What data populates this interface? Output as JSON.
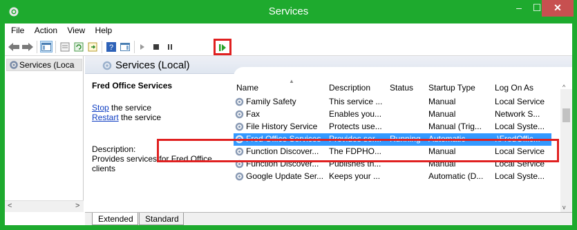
{
  "window": {
    "title": "Services",
    "minimize_glyph": "–",
    "maximize_glyph": "☐",
    "close_glyph": "✕"
  },
  "menubar": {
    "items": [
      "File",
      "Action",
      "View",
      "Help"
    ]
  },
  "toolbar": {
    "icons": [
      "back-icon",
      "forward-icon",
      "show-hide-console-tree-icon",
      "properties-icon",
      "refresh-icon",
      "export-list-icon",
      "help-icon",
      "show-action-pane-icon",
      "start-service-icon",
      "stop-service-icon",
      "pause-service-icon",
      "resume-service-icon"
    ],
    "highlighted": "resume-service-icon"
  },
  "tree": {
    "item": "Services (Loca"
  },
  "header": {
    "title": "Services (Local)"
  },
  "description_panel": {
    "service_name": "Fred Office Services",
    "stop_link": "Stop",
    "stop_suffix": " the service",
    "restart_link": "Restart",
    "restart_suffix": " the service",
    "description_label": "Description:",
    "description_line1": "Provides services for Fred Office",
    "description_line2": "clients"
  },
  "table": {
    "columns": [
      "Name",
      "Description",
      "Status",
      "Startup Type",
      "Log On As"
    ],
    "rows": [
      [
        "Family Safety",
        "This service ...",
        "",
        "Manual",
        "Local Service"
      ],
      [
        "Fax",
        "Enables you...",
        "",
        "Manual",
        "Network S..."
      ],
      [
        "File History Service",
        "Protects use...",
        "",
        "Manual (Trig...",
        "Local Syste..."
      ],
      [
        "Fred Office Services",
        "Provides ser...",
        "Running",
        "Automatic",
        ".\\FredOffic..."
      ],
      [
        "Function Discover...",
        "The FDPHO...",
        "",
        "Manual",
        "Local Service"
      ],
      [
        "Function Discover...",
        "Publishes th...",
        "",
        "Manual",
        "Local Service"
      ],
      [
        "Google Update Ser...",
        "Keeps your ...",
        "",
        "Automatic (D...",
        "Local Syste..."
      ]
    ],
    "selected_index": 3
  },
  "tabs": {
    "extended": "Extended",
    "standard": "Standard"
  },
  "colors": {
    "titlebar": "#1eaa2e",
    "selection": "#3399ff",
    "highlight_box": "#e02020",
    "link": "#0c3cc2"
  }
}
